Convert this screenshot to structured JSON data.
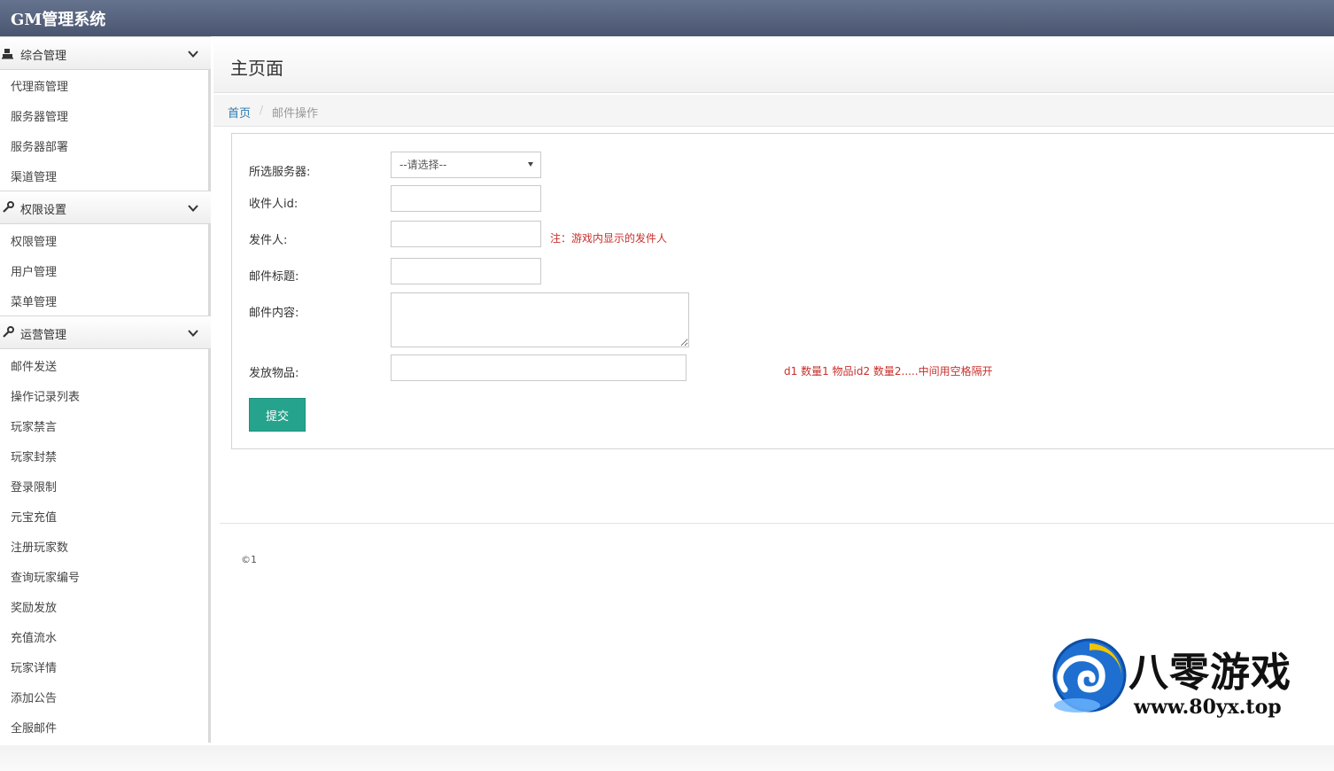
{
  "app": {
    "title": "GM管理系统"
  },
  "sidebar": {
    "groups": [
      {
        "label": "综合管理",
        "icon": "user-icon",
        "items": [
          "代理商管理",
          "服务器管理",
          "服务器部署",
          "渠道管理"
        ]
      },
      {
        "label": "权限设置",
        "icon": "wrench-icon",
        "items": [
          "权限管理",
          "用户管理",
          "菜单管理"
        ]
      },
      {
        "label": "运营管理",
        "icon": "wrench-icon",
        "items": [
          "邮件发送",
          "操作记录列表",
          "玩家禁言",
          "玩家封禁",
          "登录限制",
          "元宝充值",
          "注册玩家数",
          "查询玩家编号",
          "奖励发放",
          "充值流水",
          "玩家详情",
          "添加公告",
          "全服邮件"
        ]
      }
    ]
  },
  "page": {
    "title": "主页面",
    "breadcrumb": {
      "home": "首页",
      "separator": "/",
      "current": "邮件操作"
    }
  },
  "form": {
    "server": {
      "label": "所选服务器:",
      "selected": "--请选择--"
    },
    "recipient_id": {
      "label": "收件人id:",
      "value": ""
    },
    "sender": {
      "label": "发件人:",
      "value": "",
      "note": "注：游戏内显示的发件人"
    },
    "mail_title": {
      "label": "邮件标题:",
      "value": ""
    },
    "mail_content": {
      "label": "邮件内容:",
      "value": ""
    },
    "items": {
      "label": "发放物品:",
      "value": "",
      "note": "d1 数量1 物品id2 数量2.....中间用空格隔开"
    },
    "submit_label": "提交"
  },
  "footer": {
    "text": "©1"
  },
  "watermark": {
    "name": "八零游戏",
    "url": "www.80yx.top"
  },
  "colors": {
    "topbar": "#55617b",
    "accent_button": "#26a38d",
    "note_red": "#c9302c",
    "link_blue": "#2a7ab0"
  }
}
